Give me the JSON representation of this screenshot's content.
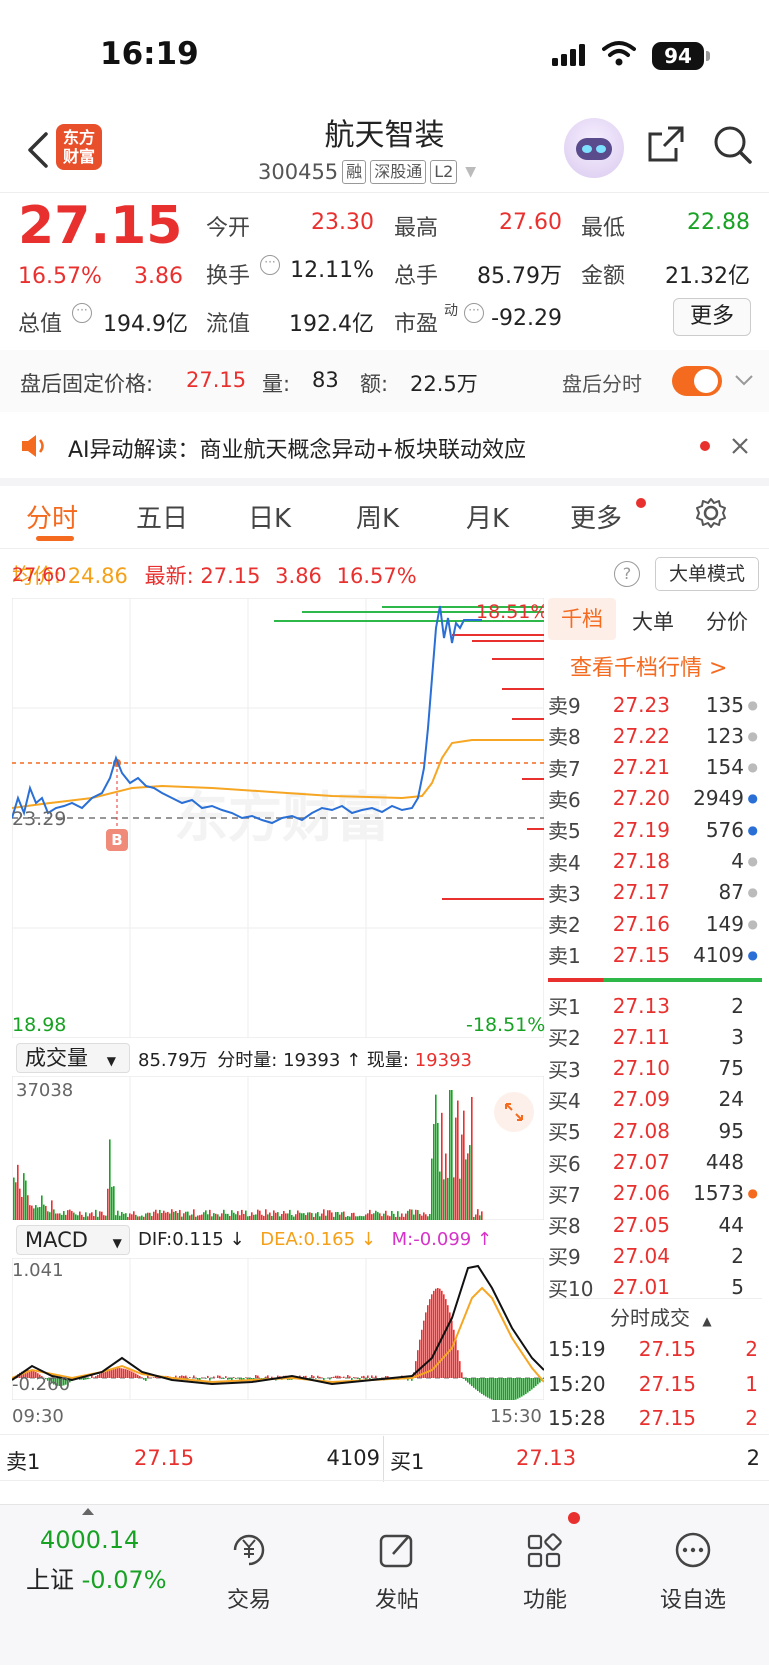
{
  "status_bar": {
    "time": "16:19",
    "battery": "94"
  },
  "header": {
    "logo": "东方财富",
    "stock_name": "航天智装",
    "stock_code": "300455",
    "tags": [
      "融",
      "深股通",
      "L2"
    ]
  },
  "quote": {
    "price": "27.15",
    "change_pct": "16.57%",
    "change": "3.86",
    "open_label": "今开",
    "open": "23.30",
    "high_label": "最高",
    "high": "27.60",
    "low_label": "最低",
    "low": "22.88",
    "turnover_label": "换手",
    "turnover": "12.11%",
    "volume_label": "总手",
    "volume": "85.79万",
    "amount_label": "金额",
    "amount": "21.32亿",
    "mktcap_label": "总值",
    "mktcap": "194.9亿",
    "float_label": "流值",
    "float": "192.4亿",
    "pe_label": "市盈",
    "pe_sup": "动",
    "pe": "-92.29",
    "more": "更多"
  },
  "after_hours": {
    "price_label": "盘后固定价格:",
    "price": "27.15",
    "vol_label": "量:",
    "vol": "83",
    "amt_label": "额:",
    "amt": "22.5万",
    "toggle_label": "盘后分时"
  },
  "ai_banner": {
    "text": "AI异动解读：商业航天概念异动+板块联动效应"
  },
  "tabs": [
    "分时",
    "五日",
    "日K",
    "周K",
    "月K",
    "更多"
  ],
  "chart_header": {
    "avg_label": "均价:",
    "avg": "24.86",
    "latest_label": "最新:",
    "latest": "27.15",
    "latest_chg": "3.86",
    "latest_pct": "16.57%",
    "bigorder": "大单模式"
  },
  "price_axis": {
    "top": "27.60",
    "mid": "23.29",
    "bottom": "18.98",
    "top_pct": "18.51%",
    "bottom_pct": "-18.51%"
  },
  "volume_panel": {
    "selector": "成交量",
    "total": "85.79万",
    "tick_label": "分时量:",
    "tick_vol": "19393",
    "now_label": "现量:",
    "now_vol": "19393",
    "max": "37038"
  },
  "macd_panel": {
    "selector": "MACD",
    "dif": "DIF:0.115 ↓",
    "dea": "DEA:0.165 ↓",
    "m": "M:-0.099 ↑",
    "top": "1.041",
    "bottom": "-0.260",
    "time_start": "09:30",
    "time_end": "15:30"
  },
  "order_book": {
    "tabs": [
      "千档",
      "大单",
      "分价"
    ],
    "link": "查看千档行情 >",
    "asks": [
      {
        "label": "卖9",
        "price": "27.23",
        "vol": "135",
        "dot": "#bbb"
      },
      {
        "label": "卖8",
        "price": "27.22",
        "vol": "123",
        "dot": "#bbb"
      },
      {
        "label": "卖7",
        "price": "27.21",
        "vol": "154",
        "dot": "#bbb"
      },
      {
        "label": "卖6",
        "price": "27.20",
        "vol": "2949",
        "dot": "#2a6fd6"
      },
      {
        "label": "卖5",
        "price": "27.19",
        "vol": "576",
        "dot": "#2a6fd6"
      },
      {
        "label": "卖4",
        "price": "27.18",
        "vol": "4",
        "dot": "#bbb"
      },
      {
        "label": "卖3",
        "price": "27.17",
        "vol": "87",
        "dot": "#bbb"
      },
      {
        "label": "卖2",
        "price": "27.16",
        "vol": "149",
        "dot": "#bbb"
      },
      {
        "label": "卖1",
        "price": "27.15",
        "vol": "4109",
        "dot": "#2a6fd6"
      }
    ],
    "bids": [
      {
        "label": "买1",
        "price": "27.13",
        "vol": "2",
        "dot": ""
      },
      {
        "label": "买2",
        "price": "27.11",
        "vol": "3",
        "dot": ""
      },
      {
        "label": "买3",
        "price": "27.10",
        "vol": "75",
        "dot": ""
      },
      {
        "label": "买4",
        "price": "27.09",
        "vol": "24",
        "dot": ""
      },
      {
        "label": "买5",
        "price": "27.08",
        "vol": "95",
        "dot": ""
      },
      {
        "label": "买6",
        "price": "27.07",
        "vol": "448",
        "dot": ""
      },
      {
        "label": "买7",
        "price": "27.06",
        "vol": "1573",
        "dot": "#f46a1f"
      },
      {
        "label": "买8",
        "price": "27.05",
        "vol": "44",
        "dot": ""
      },
      {
        "label": "买9",
        "price": "27.04",
        "vol": "2",
        "dot": ""
      },
      {
        "label": "买10",
        "price": "27.01",
        "vol": "5",
        "dot": ""
      }
    ],
    "trades_title": "分时成交",
    "trades": [
      {
        "time": "15:19",
        "price": "27.15",
        "vol": "2"
      },
      {
        "time": "15:20",
        "price": "27.15",
        "vol": "1"
      },
      {
        "time": "15:28",
        "price": "27.15",
        "vol": "2"
      }
    ]
  },
  "bottom_quote": {
    "sell_label": "卖1",
    "sell_price": "27.15",
    "sell_vol": "4109",
    "buy_label": "买1",
    "buy_price": "27.13",
    "buy_vol": "2"
  },
  "bottom_bar": {
    "index_value": "4000.14",
    "index_name": "上证",
    "index_pct": "-0.07%",
    "items": [
      "交易",
      "发帖",
      "功能",
      "设自选"
    ]
  }
}
